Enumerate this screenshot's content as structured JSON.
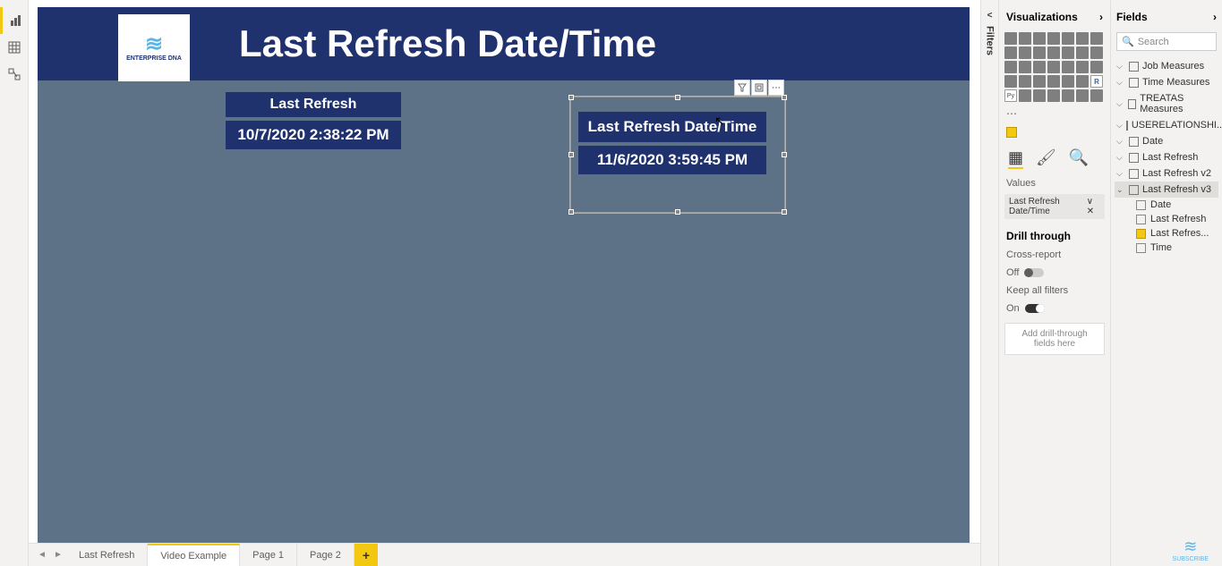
{
  "viewSwitcher": {
    "report": "Report",
    "data": "Data",
    "model": "Model"
  },
  "report": {
    "title": "Last Refresh Date/Time",
    "logoText": "ENTERPRISE DNA"
  },
  "card1": {
    "header": "Last Refresh",
    "value": "10/7/2020 2:38:22 PM"
  },
  "card2": {
    "header": "Last Refresh Date/Time",
    "value": "11/6/2020 3:59:45 PM"
  },
  "visualToolbar": {
    "filter": "▼",
    "focus": "⤢",
    "more": "⋯"
  },
  "pageTabs": {
    "tabs": [
      "Last Refresh",
      "Video Example",
      "Page 1",
      "Page 2"
    ],
    "activeIndex": 1,
    "addLabel": "+"
  },
  "filtersPane": {
    "label": "Filters"
  },
  "vizPanel": {
    "title": "Visualizations",
    "valuesLabel": "Values",
    "valueField": "Last Refresh Date/Time",
    "drillTitle": "Drill through",
    "crossReportLabel": "Cross-report",
    "crossReportValue": "Off",
    "keepFiltersLabel": "Keep all filters",
    "keepFiltersValue": "On",
    "drillDrop": "Add drill-through fields here"
  },
  "fieldsPanel": {
    "title": "Fields",
    "searchPlaceholder": "Search",
    "tables": [
      {
        "name": "Job Measures",
        "type": "measure"
      },
      {
        "name": "Time Measures",
        "type": "measure"
      },
      {
        "name": "TREATAS Measures",
        "type": "measure"
      },
      {
        "name": "USERELATIONSHI...",
        "type": "measure"
      },
      {
        "name": "Date",
        "type": "table"
      },
      {
        "name": "Last Refresh",
        "type": "table"
      },
      {
        "name": "Last Refresh v2",
        "type": "table"
      },
      {
        "name": "Last Refresh v3",
        "type": "table",
        "expanded": true,
        "selected": true,
        "fields": [
          {
            "name": "Date",
            "checked": false
          },
          {
            "name": "Last Refresh",
            "checked": false
          },
          {
            "name": "Last Refres...",
            "checked": true
          },
          {
            "name": "Time",
            "checked": false
          }
        ]
      }
    ]
  },
  "subscribe": "SUBSCRIBE"
}
